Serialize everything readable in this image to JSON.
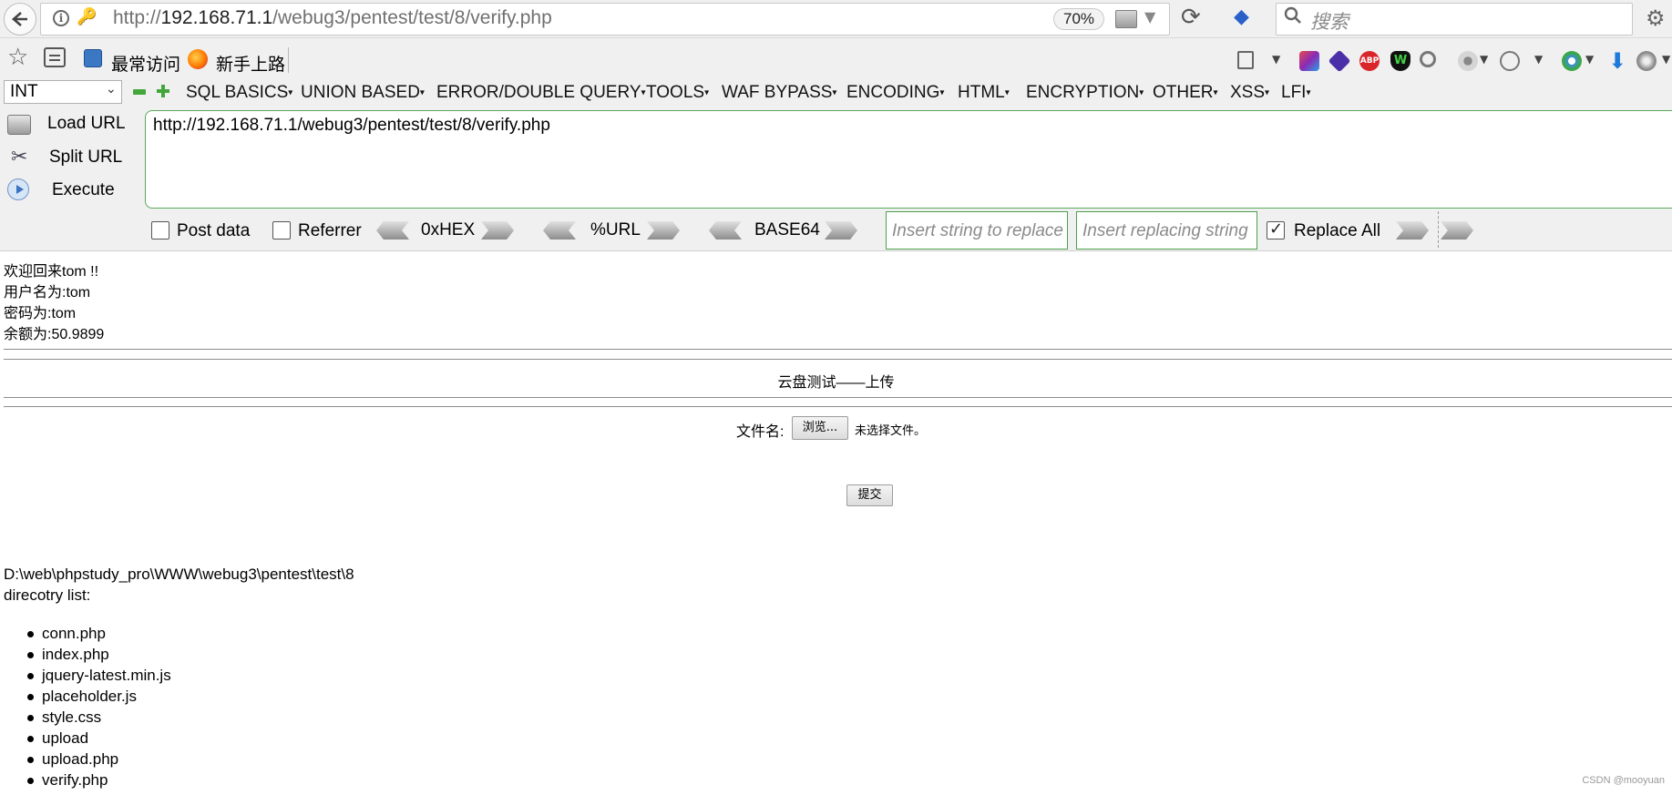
{
  "browser": {
    "url_prefix": "http://",
    "url_host": "192.168.71.1",
    "url_path": "/webug3/pentest/test/8/verify.php",
    "zoom": "70%",
    "search_placeholder": "搜索"
  },
  "bookmarks": {
    "most_visited": "最常访问",
    "getting_started": "新手上路"
  },
  "hackbar": {
    "type_select": "INT",
    "menus": [
      "SQL BASICS",
      "UNION BASED",
      "ERROR/DOUBLE QUERY",
      "TOOLS",
      "WAF BYPASS",
      "ENCODING",
      "HTML",
      "ENCRYPTION",
      "OTHER",
      "XSS",
      "LFI"
    ],
    "load_url": "Load URL",
    "split_url": "Split URL",
    "execute": "Execute",
    "url_value": "http://192.168.71.1/webug3/pentest/test/8/verify.php",
    "post_data": "Post data",
    "referrer": "Referrer",
    "hex": "0xHEX",
    "url_enc": "%URL",
    "base64": "BASE64",
    "replace_placeholder": "Insert string to replace",
    "replacing_placeholder": "Insert replacing string",
    "replace_all": "Replace All"
  },
  "page": {
    "welcome": "欢迎回来tom !!",
    "username": "用户名为:tom",
    "password": "密码为:tom",
    "balance": "余额为:50.9899",
    "upload_title": "云盘测试——上传",
    "file_label": "文件名:",
    "browse_button": "浏览...",
    "no_file": "未选择文件。",
    "submit_button": "提交",
    "path": "D:\\web\\phpstudy_pro\\WWW\\webug3\\pentest\\test\\8",
    "dir_label": "direcotry list:",
    "files": [
      "conn.php",
      "index.php",
      "jquery-latest.min.js",
      "placeholder.js",
      "style.css",
      "upload",
      "upload.php",
      "verify.php"
    ]
  },
  "watermark": "CSDN @mooyuan"
}
